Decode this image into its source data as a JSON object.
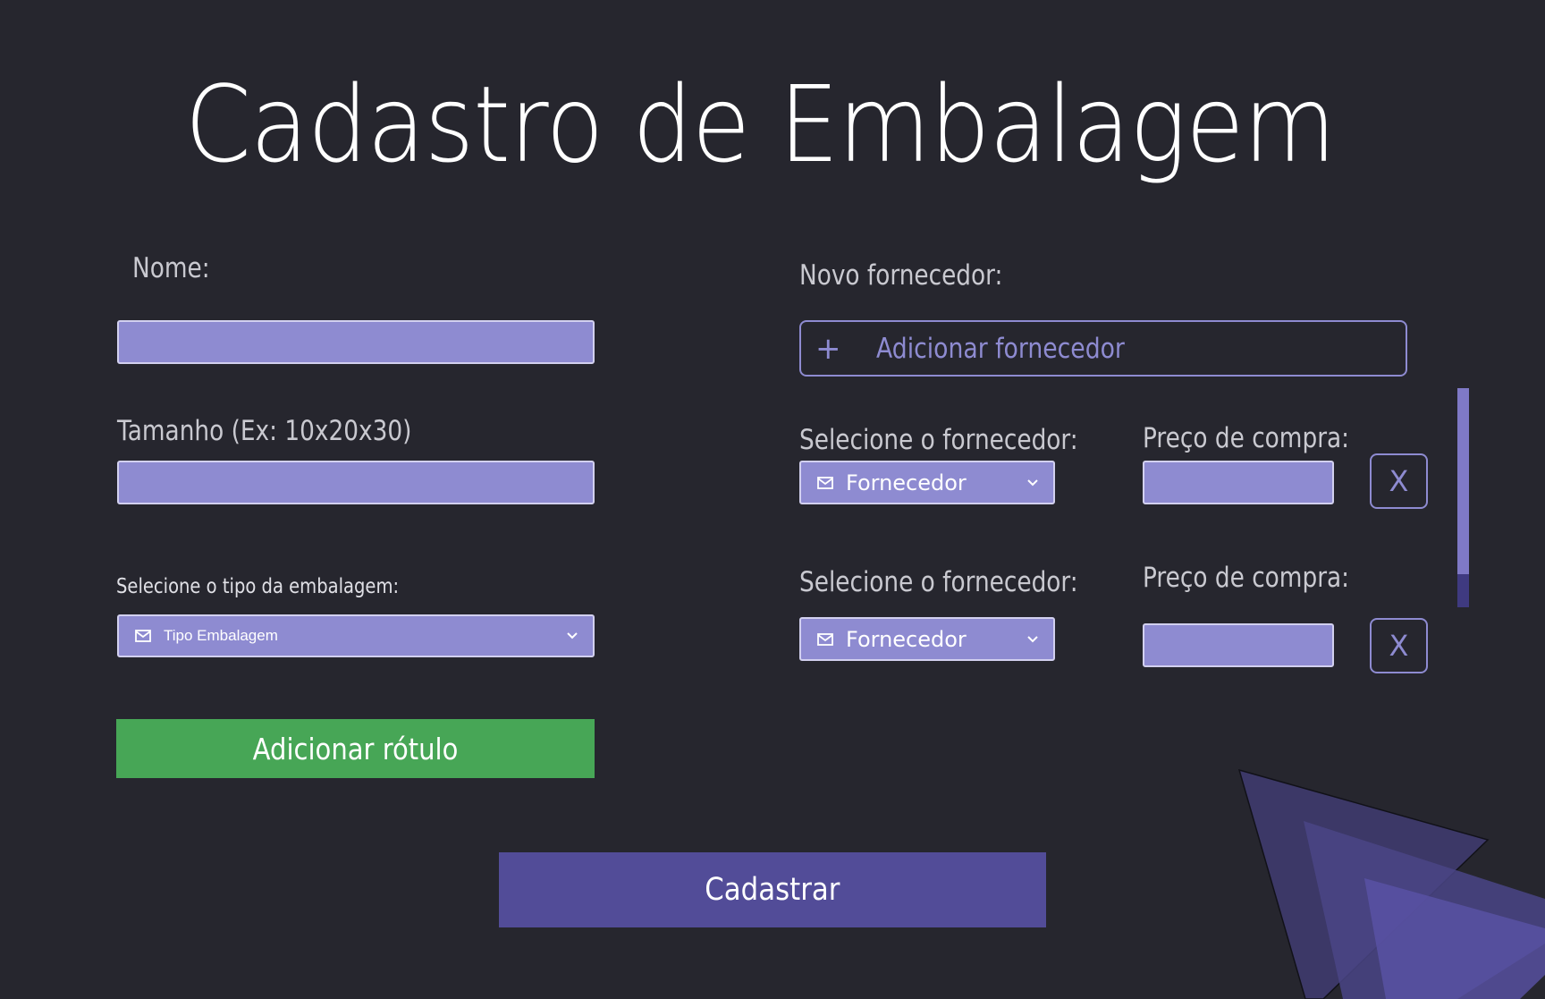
{
  "page": {
    "title": "Cadastro de Embalagem"
  },
  "left": {
    "name_label": "Nome:",
    "name_value": "",
    "size_label": "Tamanho (Ex: 10x20x30)",
    "size_value": "",
    "type_label": "Selecione o tipo da embalagem:",
    "type_select": "Tipo Embalagem",
    "add_label_button": "Adicionar rótulo"
  },
  "right": {
    "new_supplier_label": "Novo fornecedor:",
    "add_supplier_plus": "+",
    "add_supplier_button": "Adicionar fornecedor",
    "rows": [
      {
        "supplier_label": "Selecione o fornecedor:",
        "supplier_select": "Fornecedor",
        "price_label": "Preço de compra:",
        "price_value": "",
        "remove": "X"
      },
      {
        "supplier_label": "Selecione o fornecedor:",
        "supplier_select": "Fornecedor",
        "price_label": "Preço de compra:",
        "price_value": "",
        "remove": "X"
      }
    ]
  },
  "submit_button": "Cadastrar",
  "colors": {
    "background": "#26262e",
    "field": "#8e8bd1",
    "green": "#47a656",
    "primary": "#524c98"
  },
  "icons": {
    "select_icon": "mail-icon",
    "dropdown_icon": "chevron-down-icon",
    "add_icon": "plus-icon"
  }
}
